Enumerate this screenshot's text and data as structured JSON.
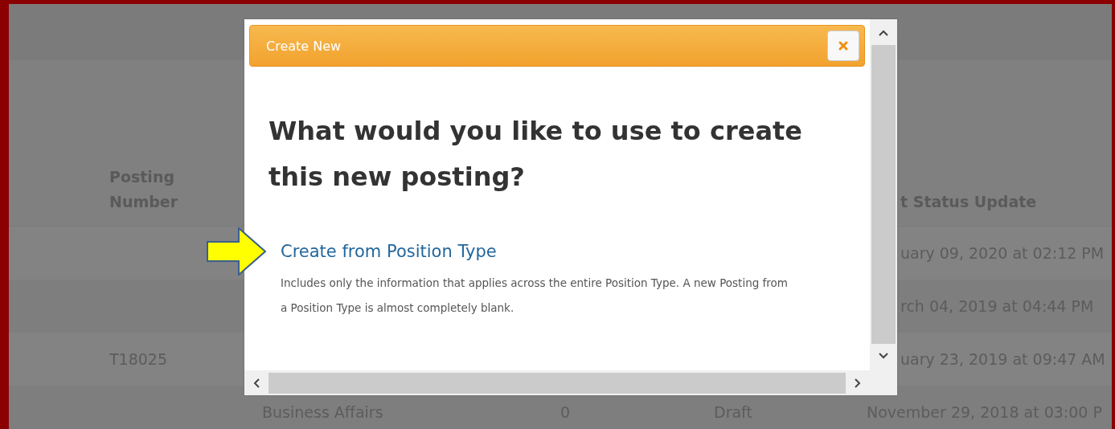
{
  "background_table": {
    "columns": [
      {
        "label": "Posting Number"
      },
      {
        "label": "t Status Update"
      }
    ],
    "rows": [
      {
        "column_5": "uary 09, 2020 at 02:12 PM"
      },
      {
        "column_5": "rch 04, 2019 at 04:44 PM"
      },
      {
        "posting_number": "T18025",
        "column_5": "uary 23, 2019 at 09:47 AM"
      },
      {
        "column_2": "Business Affairs",
        "column_3": "0",
        "column_4": "Draft",
        "column_5": "November 29, 2018 at 03:00 P"
      }
    ]
  },
  "dialog": {
    "title": "Create New",
    "heading": "What would you like to use to create this new posting?",
    "options": [
      {
        "label": "Create from Position Type",
        "description": "Includes only the information that applies across the entire Position Type. A new Posting from a Position Type is almost completely blank."
      }
    ]
  }
}
